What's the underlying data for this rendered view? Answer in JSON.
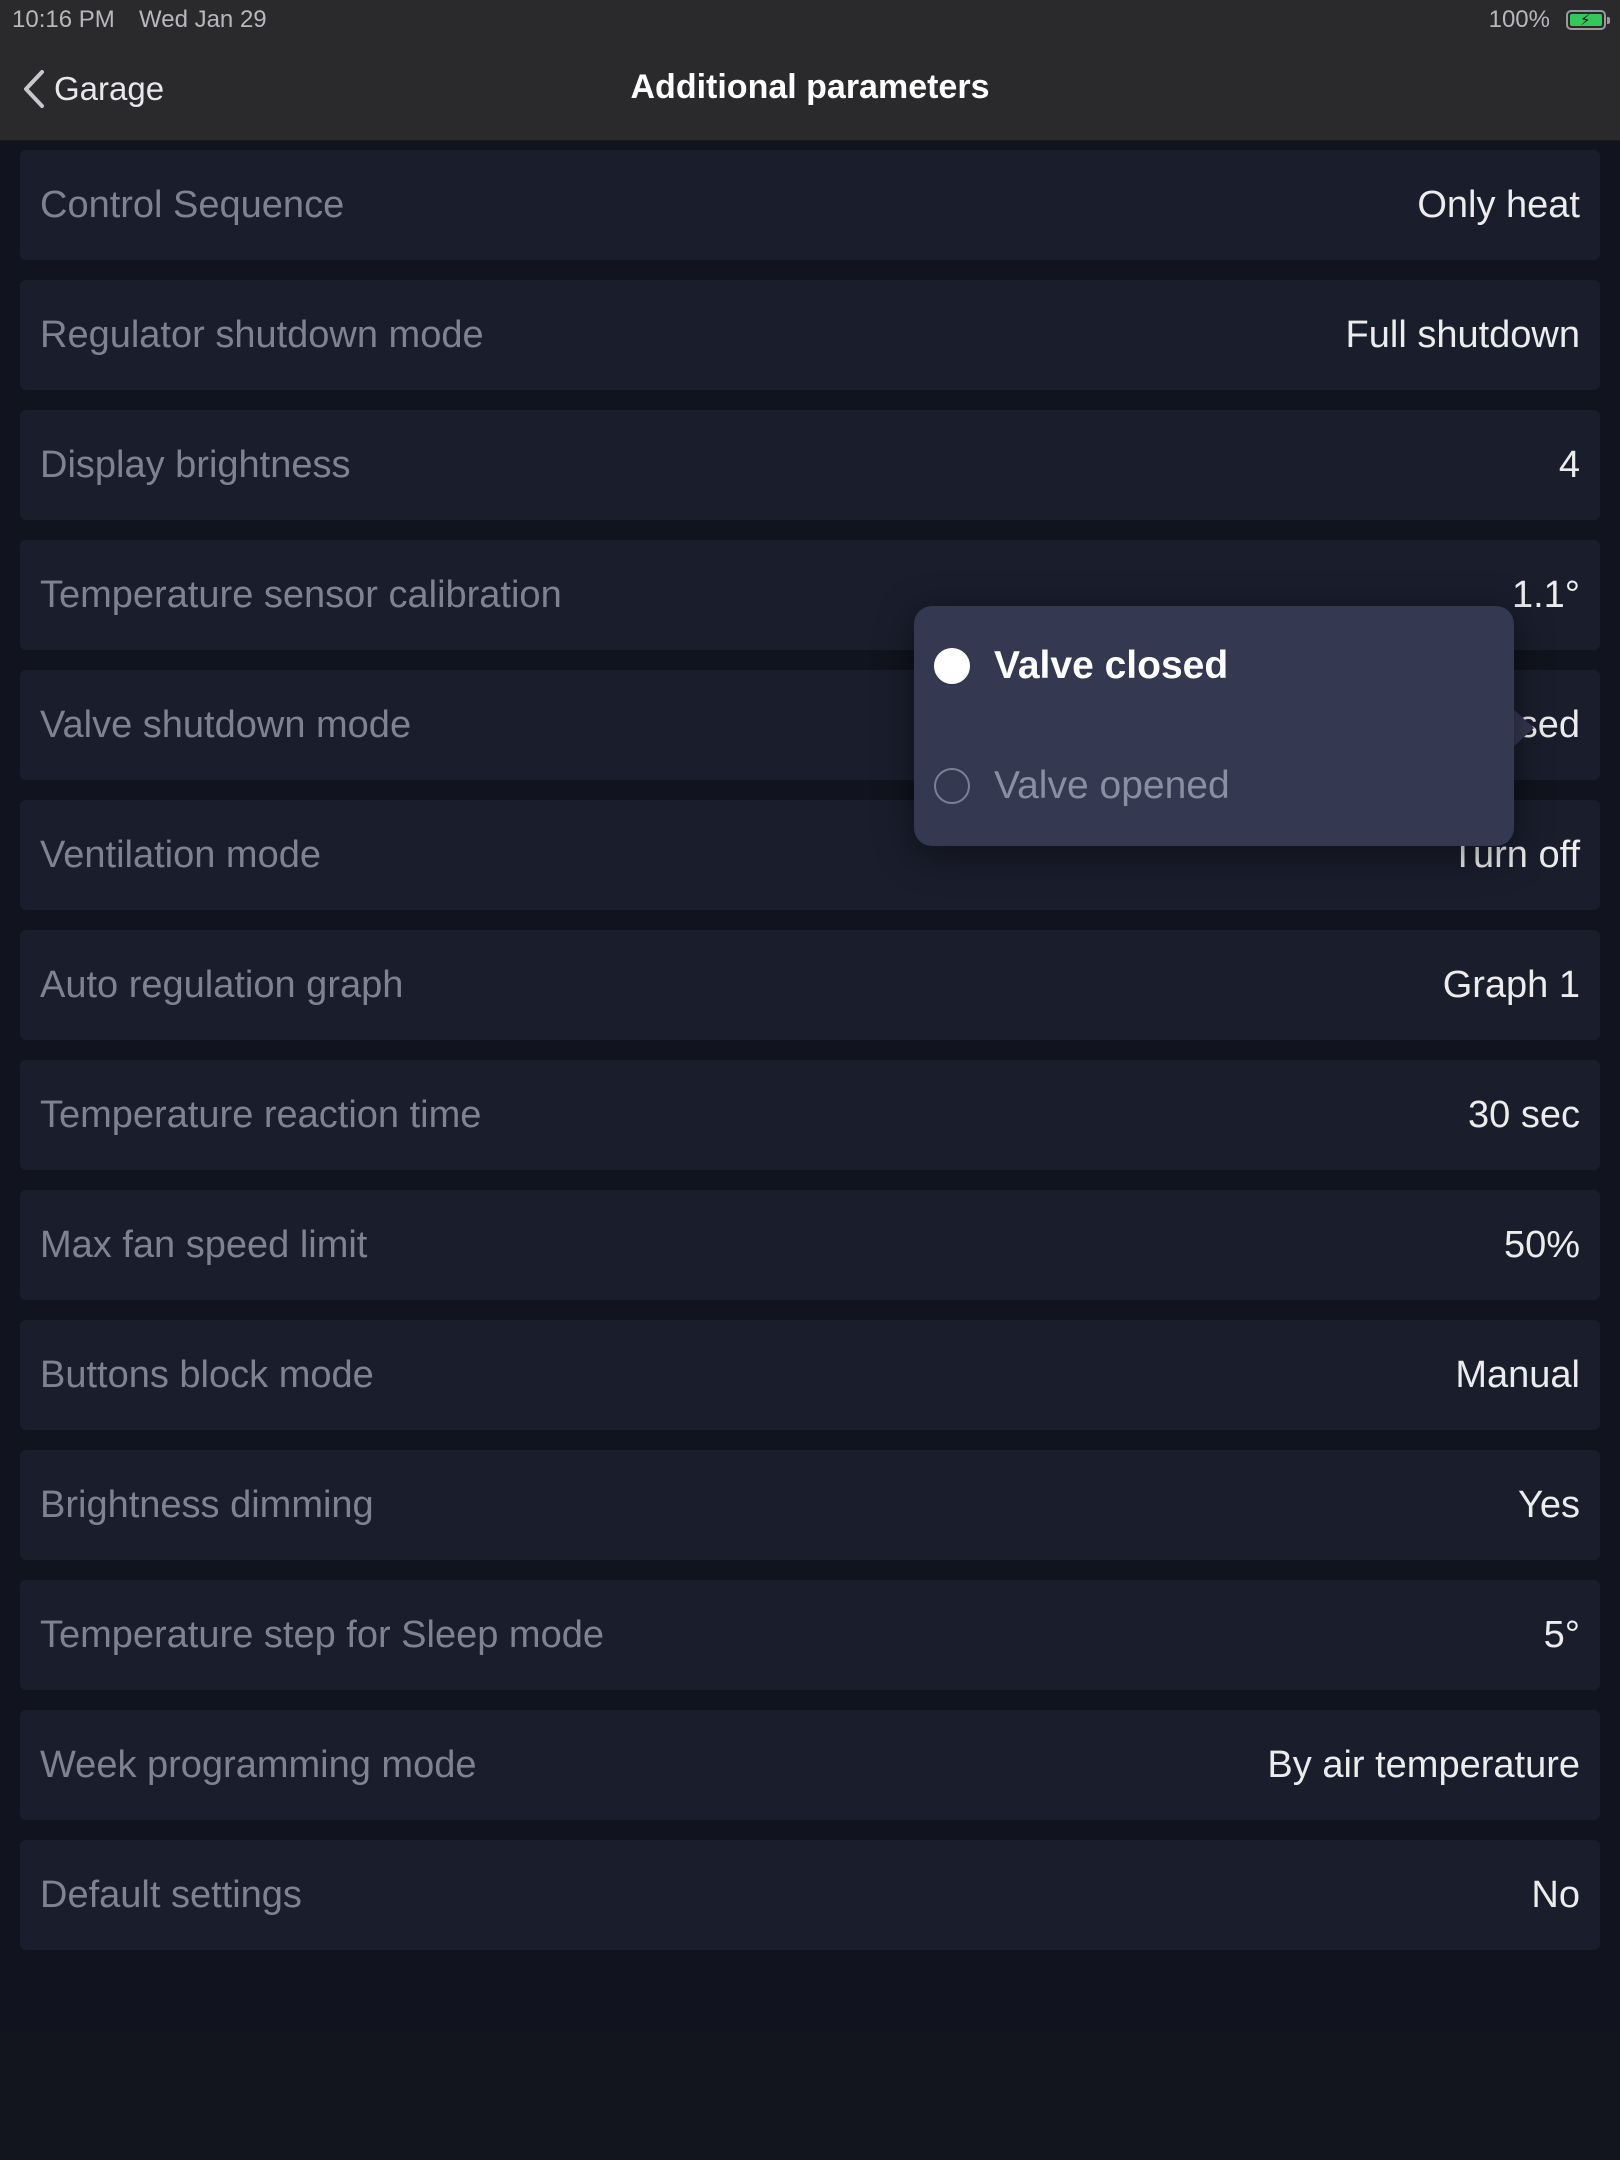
{
  "status_bar": {
    "time": "10:16 PM",
    "date": "Wed Jan 29",
    "battery_percent": "100%",
    "battery_level": 1.0
  },
  "nav": {
    "back_label": "Garage",
    "title": "Additional parameters"
  },
  "rows": [
    {
      "label": "Control Sequence",
      "value": "Only heat"
    },
    {
      "label": "Regulator shutdown mode",
      "value": "Full shutdown"
    },
    {
      "label": "Display brightness",
      "value": "4"
    },
    {
      "label": "Temperature sensor calibration",
      "value": "1.1°"
    },
    {
      "label": "Valve shutdown mode",
      "value": "Valve closed"
    },
    {
      "label": "Ventilation mode",
      "value": "Turn off"
    },
    {
      "label": "Auto regulation graph",
      "value": "Graph 1"
    },
    {
      "label": "Temperature reaction time",
      "value": "30 sec"
    },
    {
      "label": "Max fan speed limit",
      "value": "50%"
    },
    {
      "label": "Buttons block mode",
      "value": "Manual"
    },
    {
      "label": "Brightness dimming",
      "value": "Yes"
    },
    {
      "label": "Temperature step for Sleep mode",
      "value": "5°"
    },
    {
      "label": "Week programming mode",
      "value": "By air temperature"
    },
    {
      "label": "Default settings",
      "value": "No"
    }
  ],
  "popover": {
    "options": [
      {
        "label": "Valve closed",
        "selected": true
      },
      {
        "label": "Valve opened",
        "selected": false
      }
    ]
  },
  "colors": {
    "background": "#12141f",
    "row_background": "#1c1f2e",
    "popover_background": "#343850",
    "bar_background": "#2a2a2d",
    "battery_green": "#34c759"
  }
}
